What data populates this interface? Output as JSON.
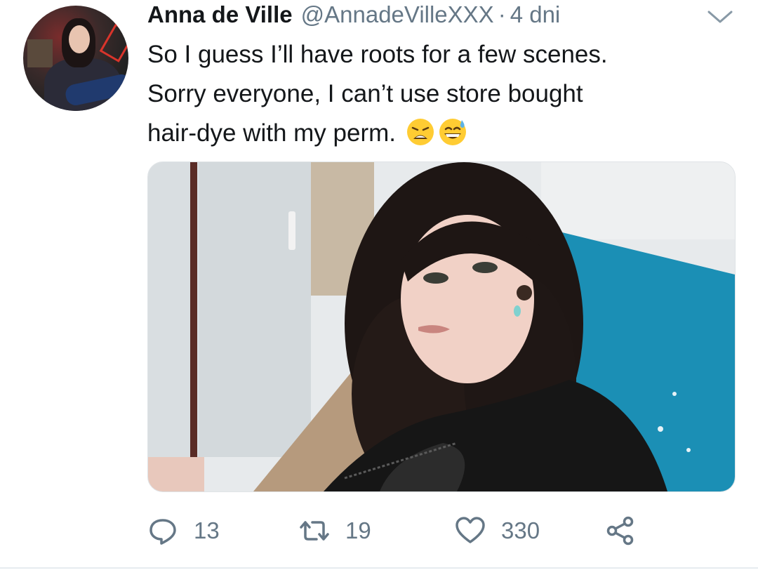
{
  "tweet": {
    "author_name": "Anna de Ville",
    "handle": "@AnnadeVilleXXX",
    "separator": "·",
    "time": "4 dni",
    "text_lines": [
      "So I guess I’ll have roots for a few scenes.",
      "Sorry everyone, I can’t use store bought",
      "hair-dye with my perm."
    ],
    "emojis": [
      "weary-face-emoji",
      "grinning-face-with-sweat-emoji"
    ],
    "media": {
      "description_icon": "photo"
    }
  },
  "actions": {
    "reply_count": "13",
    "retweet_count": "19",
    "like_count": "330"
  },
  "icons": {
    "reply": "reply-icon",
    "retweet": "retweet-icon",
    "like": "heart-icon",
    "share": "share-icon",
    "menu": "chevron-down-icon"
  },
  "colors": {
    "text": "#14171a",
    "secondary": "#657786",
    "divider": "#e6ecf0"
  }
}
